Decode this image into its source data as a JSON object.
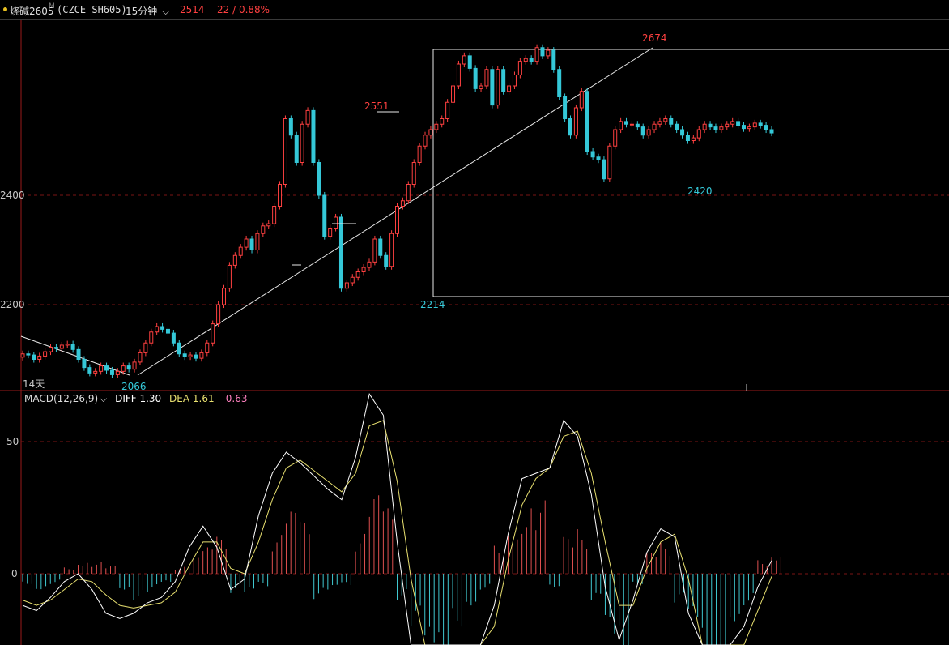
{
  "header": {
    "name": "烧碱2605",
    "marker": "M",
    "code": "(CZCE SH605)",
    "period": "15分钟",
    "period_arrow": "⌵",
    "price": "2514",
    "change": "22 / 0.88%"
  },
  "colors": {
    "up": "#ff4040",
    "down": "#35c8d8",
    "grid": "#7a1414",
    "divider": "#9a1a1a",
    "dot": "#e8c020",
    "diff": "#ffffff",
    "dea": "#e8e070",
    "header_yellow": "#e8c020"
  },
  "main_chart": {
    "y_labels": [
      "2400",
      "2200"
    ],
    "range_label": "14天",
    "annotations": [
      {
        "text": "2674",
        "kind": "high"
      },
      {
        "text": "2551",
        "kind": "high"
      },
      {
        "text": "2420",
        "kind": "low"
      },
      {
        "text": "2214",
        "kind": "low"
      },
      {
        "text": "2066",
        "kind": "low"
      }
    ]
  },
  "macd": {
    "label": "MACD(12,26,9)",
    "arrow": "⌵",
    "diff_label": "DIFF 1.30",
    "dea_label": "DEA 1.61",
    "macd_value": "-0.63",
    "y_labels": [
      "50",
      "0"
    ]
  },
  "chart_data": {
    "type": "candlestick",
    "y_axis_labels": [
      2400,
      2200
    ],
    "closes": [
      2110,
      2108,
      2100,
      2106,
      2114,
      2122,
      2120,
      2126,
      2128,
      2118,
      2100,
      2085,
      2075,
      2078,
      2088,
      2080,
      2072,
      2078,
      2088,
      2082,
      2095,
      2112,
      2130,
      2150,
      2160,
      2155,
      2148,
      2130,
      2110,
      2105,
      2108,
      2102,
      2112,
      2130,
      2165,
      2200,
      2230,
      2272,
      2290,
      2305,
      2320,
      2300,
      2330,
      2344,
      2348,
      2380,
      2420,
      2540,
      2510,
      2460,
      2530,
      2555,
      2460,
      2400,
      2325,
      2340,
      2360,
      2230,
      2240,
      2250,
      2260,
      2268,
      2278,
      2320,
      2290,
      2270,
      2330,
      2380,
      2390,
      2420,
      2460,
      2490,
      2510,
      2520,
      2530,
      2540,
      2570,
      2600,
      2640,
      2655,
      2632,
      2595,
      2600,
      2630,
      2565,
      2630,
      2590,
      2600,
      2620,
      2645,
      2650,
      2645,
      2670,
      2655,
      2665,
      2630,
      2580,
      2540,
      2510,
      2560,
      2590,
      2480,
      2470,
      2465,
      2430,
      2490,
      2520,
      2535,
      2530,
      2530,
      2525,
      2510,
      2520,
      2530,
      2535,
      2540,
      2530,
      2520,
      2510,
      2500,
      2505,
      2520,
      2530,
      2525,
      2520,
      2525,
      2530,
      2535,
      2528,
      2522,
      2525,
      2532,
      2528,
      2520,
      2514
    ],
    "highs": {
      "2674": "peak",
      "2551": "peak"
    },
    "lows": {
      "2420": "trough",
      "2214": "trough",
      "2066": "trough"
    },
    "macd": {
      "diff": [
        -12,
        -14,
        -9,
        -3,
        0,
        -6,
        -15,
        -17,
        -15,
        -11,
        -9,
        -3,
        10,
        18,
        10,
        -6,
        -2,
        22,
        38,
        46,
        42,
        37,
        32,
        28,
        44,
        68,
        60,
        12,
        -28,
        -58,
        -72,
        -56,
        -40,
        -30,
        -12,
        15,
        36,
        38,
        40,
        58,
        52,
        30,
        -5,
        -25,
        -10,
        8,
        17,
        14,
        -15,
        -48,
        -62,
        -44,
        -20,
        -5,
        5
      ],
      "dea": [
        -10,
        -12,
        -10,
        -6,
        -2,
        -3,
        -8,
        -12,
        -13,
        -12,
        -11,
        -7,
        3,
        12,
        12,
        2,
        0,
        12,
        28,
        40,
        43,
        39,
        35,
        31,
        38,
        56,
        58,
        35,
        -2,
        -35,
        -60,
        -62,
        -48,
        -35,
        -20,
        5,
        26,
        36,
        40,
        52,
        54,
        38,
        12,
        -12,
        -12,
        2,
        12,
        15,
        -2,
        -30,
        -54,
        -52,
        -32,
        -14,
        -1
      ],
      "hist": [
        -4,
        -6,
        -4,
        3,
        6,
        5,
        3,
        -6,
        -10,
        -8,
        -5,
        3,
        6,
        10,
        14,
        -8,
        -10,
        -6,
        15,
        24,
        20,
        -10,
        -8,
        -6,
        16,
        30,
        25,
        -10,
        -24,
        -40,
        -44,
        -20,
        -12,
        -6,
        12,
        22,
        30,
        28,
        -5,
        14,
        18,
        -14,
        -30,
        -36,
        -4,
        8,
        12,
        -14,
        -24,
        -40,
        -46,
        -18,
        -12,
        6,
        10
      ]
    }
  }
}
